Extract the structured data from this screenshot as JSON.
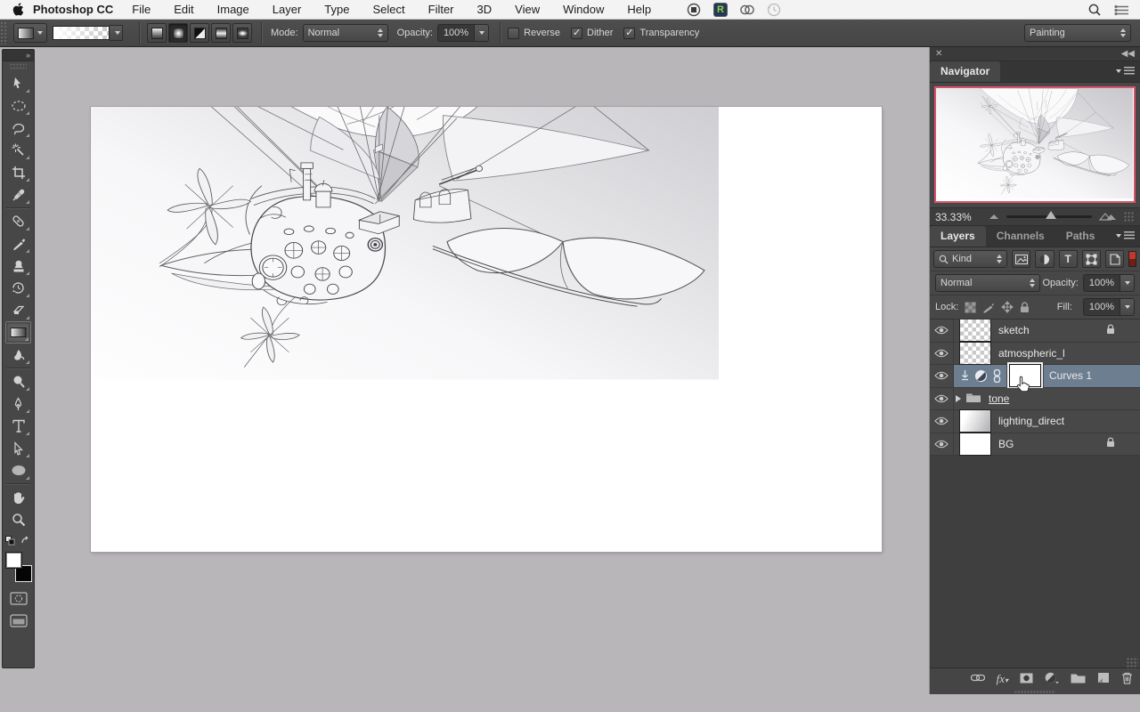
{
  "menu_bar": {
    "app_name": "Photoshop CC",
    "items": [
      "File",
      "Edit",
      "Image",
      "Layer",
      "Type",
      "Select",
      "Filter",
      "3D",
      "View",
      "Window",
      "Help"
    ]
  },
  "options_bar": {
    "mode_label": "Mode:",
    "mode_value": "Normal",
    "opacity_label": "Opacity:",
    "opacity_value": "100%",
    "reverse_label": "Reverse",
    "dither_label": "Dither",
    "transparency_label": "Transparency",
    "check_glyph": "✓",
    "workspace_value": "Painting",
    "gradient_styles": [
      "linear",
      "radial",
      "angle",
      "reflected",
      "diamond"
    ],
    "selected_gradient_style": "radial"
  },
  "toolbar": {
    "tools": [
      "move",
      "marquee",
      "lasso",
      "magic-wand",
      "crop",
      "eyedropper",
      "healing-brush",
      "brush",
      "clone-stamp",
      "history-brush",
      "eraser",
      "gradient",
      "smudge",
      "dodge",
      "pen",
      "type",
      "direct-selection",
      "shape",
      "hand",
      "zoom"
    ],
    "selected_tool": "gradient",
    "foreground_color": "#ffffff",
    "background_color": "#000000"
  },
  "navigator": {
    "title": "Navigator",
    "zoom_level": "33.33%"
  },
  "layers_panel": {
    "tabs": [
      "Layers",
      "Channels",
      "Paths"
    ],
    "active_tab": "Layers",
    "filter_value": "Kind",
    "blend_mode": "Normal",
    "opacity_label": "Opacity:",
    "opacity_value": "100%",
    "lock_label": "Lock:",
    "fill_label": "Fill:",
    "fill_value": "100%",
    "layers": [
      {
        "name": "sketch",
        "locked": true
      },
      {
        "name": "atmospheric_l",
        "locked": false
      },
      {
        "name": "Curves 1",
        "locked": false,
        "selected": true,
        "type": "adjustment-with-mask"
      },
      {
        "name": "tone",
        "locked": false,
        "type": "group"
      },
      {
        "name": "lighting_direct",
        "locked": false
      },
      {
        "name": "BG",
        "locked": true
      }
    ]
  },
  "colors": {
    "selection_highlight": "#6e7e91",
    "navigator_view_border": "#d8546b",
    "pasteboard": "#b8b6b9",
    "panel_bg": "#474747"
  }
}
